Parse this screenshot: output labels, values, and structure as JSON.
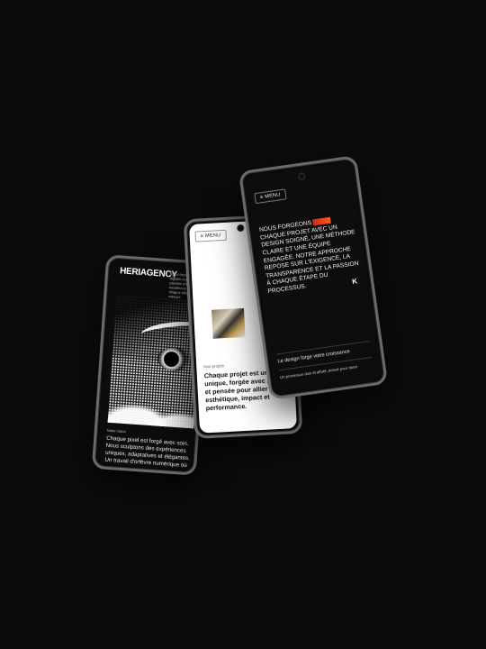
{
  "left_phone": {
    "brand": "HERIAGENCY",
    "brand_desc": "Nous façonnons image digitale avec rigueur et passion du web, excellence du detail, chaque effort sur mesure.",
    "section_label": "Notre vision",
    "body": "Chaque pixel est forgé avec soin. Nous sculptons des expériences uniques, adaptatives et élégantes. Un travail d'orfèvre numérique où l'esthétique rencontre la performance."
  },
  "center_phone": {
    "menu_label": "≡ MENU",
    "section_label": "Nos projets",
    "text": "Chaque projet est une pièce unique, forgée avec précision et pensée pour allier esthétique, impact et performance."
  },
  "right_phone": {
    "menu_label": "≡ MENU",
    "manifesto_before": "NOUS FORGEONS",
    "manifesto_after": "CHAQUE PROJET AVEC UN DESIGN SOIGNÉ, UNE MÉTHODE CLAIRE ET UNE ÉQUIPE ENGAGÉE. NOTRE APPROCHE REPOSE SUR L'EXIGENCE, LA TRANSPARENCE ET LA PASSION À CHAQUE ÉTAPE DU PROCESSUS.",
    "logo": "K",
    "footer_title": "Le design forge votre croissance",
    "footer_sub": "Un processus clair et affuté, pensé pour durer",
    "highlight_color": "#e8401c"
  }
}
